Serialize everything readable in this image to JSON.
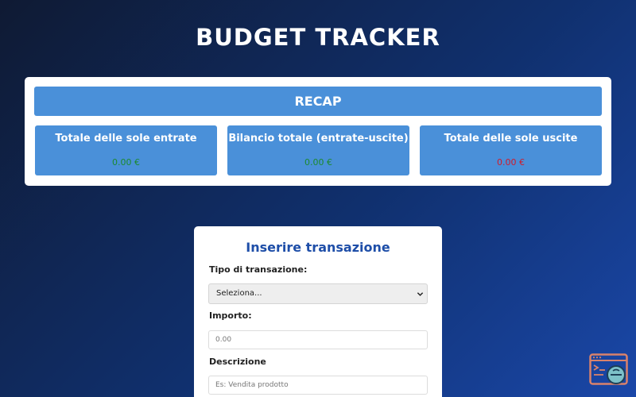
{
  "app": {
    "title": "BUDGET TRACKER"
  },
  "recap": {
    "header": "RECAP",
    "boxes": [
      {
        "title": "Totale delle sole entrate",
        "value": "0.00 €",
        "color": "#1c8a2e"
      },
      {
        "title": "Bilancio totale (entrate-uscite)",
        "value": "0.00 €",
        "color": "#1c8a2e"
      },
      {
        "title": "Totale delle sole uscite",
        "value": "0.00 €",
        "color": "#d11a2a"
      }
    ]
  },
  "form": {
    "title": "Inserire transazione",
    "type_label": "Tipo di transazione:",
    "type_selected": "Seleziona...",
    "amount_label": "Importo:",
    "amount_placeholder": "0.00",
    "description_label": "Descrizione",
    "description_placeholder": "Es: Vendita prodotto"
  },
  "icons": {
    "select_chevron": "chevron-down-icon",
    "corner": "app-logo-icon"
  },
  "colors": {
    "accent": "#4a90d9",
    "form_title": "#1e4ea8",
    "positive": "#1c8a2e",
    "negative": "#d11a2a"
  }
}
